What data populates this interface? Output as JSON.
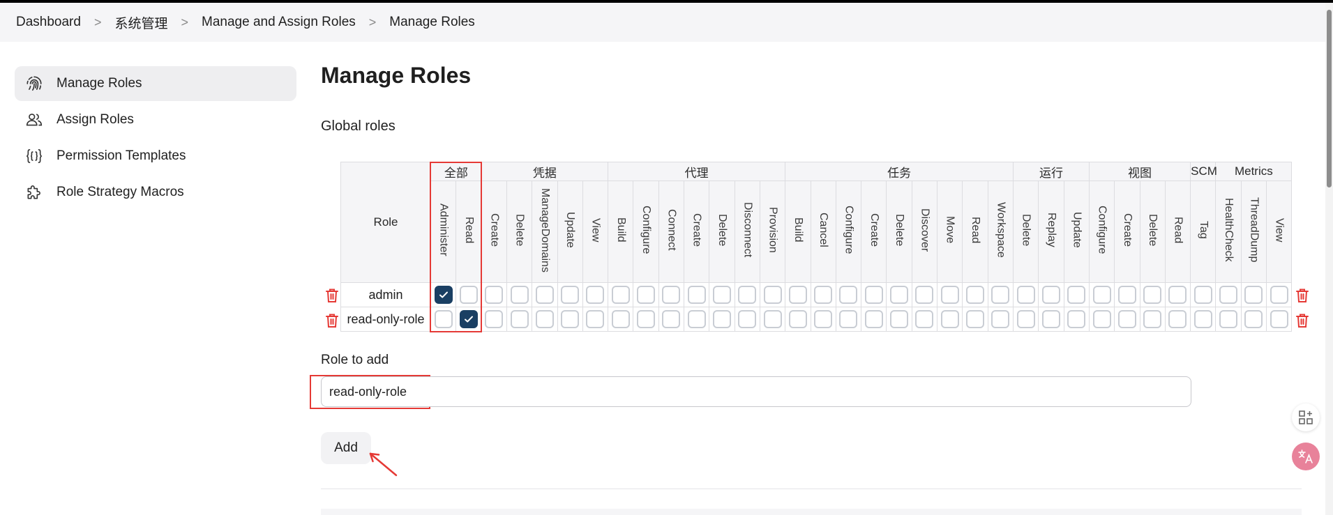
{
  "breadcrumb": {
    "items": [
      "Dashboard",
      "系统管理",
      "Manage and Assign Roles",
      "Manage Roles"
    ],
    "separator": ">"
  },
  "sidebar": {
    "items": [
      {
        "label": "Manage Roles",
        "icon": "fingerprint-icon",
        "active": true
      },
      {
        "label": "Assign Roles",
        "icon": "users-icon",
        "active": false
      },
      {
        "label": "Permission Templates",
        "icon": "braces-icon",
        "active": false
      },
      {
        "label": "Role Strategy Macros",
        "icon": "puzzle-icon",
        "active": false
      }
    ]
  },
  "main": {
    "title": "Manage Roles",
    "section": "Global roles",
    "role_header": "Role",
    "groups": [
      "全部",
      "凭据",
      "代理",
      "任务",
      "运行",
      "视图",
      "SCM",
      "Metrics"
    ],
    "permissions": {
      "g0": [
        "Administer",
        "Read"
      ],
      "g1": [
        "Create",
        "Delete",
        "ManageDomains",
        "Update",
        "View"
      ],
      "g2": [
        "Build",
        "Configure",
        "Connect",
        "Create",
        "Delete",
        "Disconnect",
        "Provision"
      ],
      "g3": [
        "Build",
        "Cancel",
        "Configure",
        "Create",
        "Delete",
        "Discover",
        "Move",
        "Read",
        "Workspace"
      ],
      "g4": [
        "Delete",
        "Replay",
        "Update"
      ],
      "g5": [
        "Configure",
        "Create",
        "Delete",
        "Read"
      ],
      "g6": [
        "Tag"
      ],
      "g7": [
        "HealthCheck",
        "ThreadDump",
        "View"
      ]
    },
    "roles": [
      {
        "name": "admin",
        "checked": [
          "g0.Administer"
        ]
      },
      {
        "name": "read-only-role",
        "checked": [
          "g0.Read"
        ]
      }
    ],
    "role_to_add_label": "Role to add",
    "role_to_add_value": "read-only-role",
    "add_button": "Add"
  },
  "colors": {
    "accent": "#1a3f63",
    "highlight": "#e53935",
    "trash": "#e53935"
  }
}
